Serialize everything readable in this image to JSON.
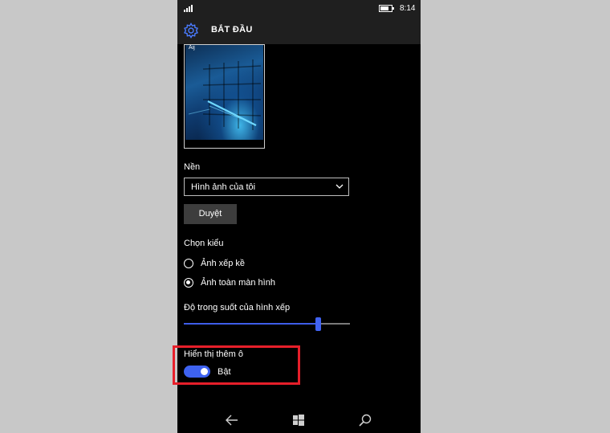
{
  "status_bar": {
    "time": "8:14",
    "signal_icon": "signal-icon",
    "battery_icon": "battery-icon",
    "battery_level": 0.8
  },
  "header": {
    "title": "BẮT ĐẦU",
    "icon": "gear-icon"
  },
  "preview": {
    "tile_label": "Aij"
  },
  "background": {
    "label": "Nền",
    "dropdown_value": "Hình ảnh của tôi",
    "browse_button": "Duyệt"
  },
  "style": {
    "label": "Chọn kiểu",
    "options": [
      {
        "label": "Ảnh xếp kề",
        "selected": false
      },
      {
        "label": "Ảnh toàn màn hình",
        "selected": true
      }
    ]
  },
  "transparency": {
    "label": "Độ trong suốt của hình xếp",
    "value": 0.81
  },
  "more_tiles": {
    "label": "Hiển thị thêm ô",
    "state_label": "Bật",
    "on": true
  },
  "nav": {
    "back_icon": "back-arrow-icon",
    "home_icon": "windows-icon",
    "search_icon": "search-icon"
  },
  "colors": {
    "accent": "#3e62f0",
    "highlight": "#e61f2a",
    "background": "#000000",
    "chrome": "#1f1f1f"
  }
}
